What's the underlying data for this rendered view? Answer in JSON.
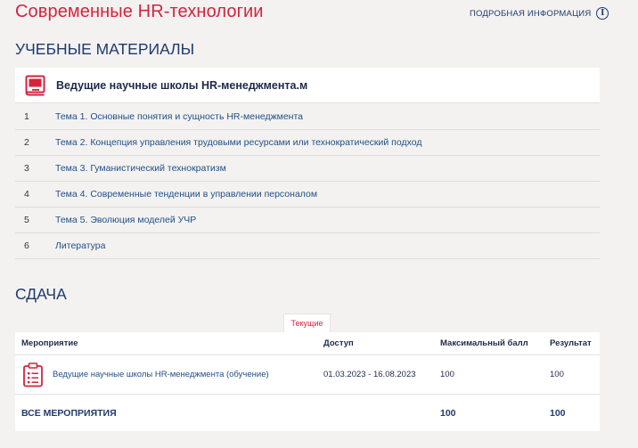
{
  "course": {
    "title": "Современные HR-технологии",
    "more_info_label": "ПОДРОБНАЯ ИНФОРМАЦИЯ",
    "info_icon": "info-circle-icon"
  },
  "materials": {
    "heading": "УЧЕБНЫЕ МАТЕРИАЛЫ",
    "card_icon": "book-icon",
    "card_title": "Ведущие научные школы HR-менеджмента.м",
    "topics": [
      {
        "num": "1",
        "title": "Тема 1. Основные понятия и сущность HR-менеджмента"
      },
      {
        "num": "2",
        "title": "Тема 2. Концепция управления трудовыми ресурсами или технократический подход"
      },
      {
        "num": "3",
        "title": "Тема 3. Гуманистический технократизм"
      },
      {
        "num": "4",
        "title": "Тема 4. Современные тенденции в управлении персоналом"
      },
      {
        "num": "5",
        "title": "Тема 5. Эволюция моделей УЧР"
      },
      {
        "num": "6",
        "title": "Литература"
      }
    ]
  },
  "submission": {
    "heading": "СДАЧА",
    "tab_current": "Текущие",
    "columns": {
      "event": "Мероприятие",
      "access": "Доступ",
      "max_score": "Максимальный балл",
      "result": "Результат"
    },
    "rows": [
      {
        "icon": "clipboard-checklist-icon",
        "event": "Ведущие научные школы HR-менеджмента (обучение)",
        "access": "01.03.2023 - 16.08.2023",
        "max_score": "100",
        "result": "100"
      }
    ],
    "total": {
      "label": "ВСЕ МЕРОПРИЯТИЯ",
      "max_score": "100",
      "result": "100"
    }
  },
  "colors": {
    "accent_red": "#d6223c",
    "navy": "#1f3a6e",
    "link_blue": "#1f4f86",
    "background": "#f3f2f1"
  }
}
